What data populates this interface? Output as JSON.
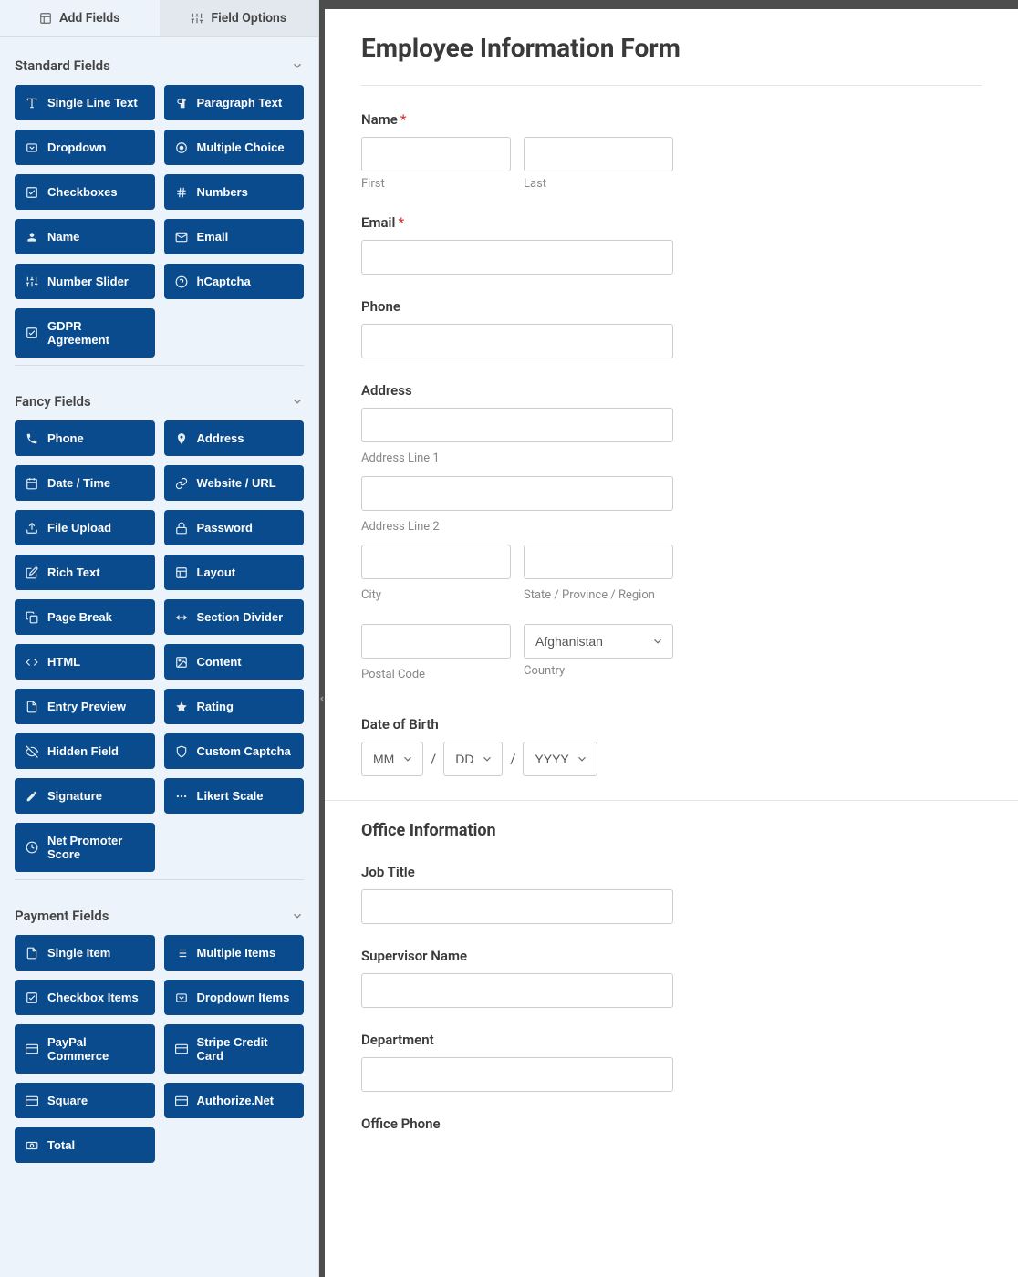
{
  "tabs": {
    "add_fields": "Add Fields",
    "field_options": "Field Options"
  },
  "sections": {
    "standard": {
      "title": "Standard Fields",
      "fields": [
        {
          "icon": "text-icon",
          "label": "Single Line Text"
        },
        {
          "icon": "paragraph-icon",
          "label": "Paragraph Text"
        },
        {
          "icon": "dropdown-icon",
          "label": "Dropdown"
        },
        {
          "icon": "radio-icon",
          "label": "Multiple Choice"
        },
        {
          "icon": "check-icon",
          "label": "Checkboxes"
        },
        {
          "icon": "hash-icon",
          "label": "Numbers"
        },
        {
          "icon": "user-icon",
          "label": "Name"
        },
        {
          "icon": "mail-icon",
          "label": "Email"
        },
        {
          "icon": "sliders-icon",
          "label": "Number Slider"
        },
        {
          "icon": "help-icon",
          "label": "hCaptcha"
        },
        {
          "icon": "check-icon",
          "label": "GDPR Agreement"
        }
      ]
    },
    "fancy": {
      "title": "Fancy Fields",
      "fields": [
        {
          "icon": "phone-icon",
          "label": "Phone"
        },
        {
          "icon": "map-pin-icon",
          "label": "Address"
        },
        {
          "icon": "calendar-icon",
          "label": "Date / Time"
        },
        {
          "icon": "link-icon",
          "label": "Website / URL"
        },
        {
          "icon": "upload-icon",
          "label": "File Upload"
        },
        {
          "icon": "lock-icon",
          "label": "Password"
        },
        {
          "icon": "edit-icon",
          "label": "Rich Text"
        },
        {
          "icon": "layout-icon",
          "label": "Layout"
        },
        {
          "icon": "copy-icon",
          "label": "Page Break"
        },
        {
          "icon": "divide-icon",
          "label": "Section Divider"
        },
        {
          "icon": "code-icon",
          "label": "HTML"
        },
        {
          "icon": "image-icon",
          "label": "Content"
        },
        {
          "icon": "file-icon",
          "label": "Entry Preview"
        },
        {
          "icon": "star-icon",
          "label": "Rating"
        },
        {
          "icon": "eye-off-icon",
          "label": "Hidden Field"
        },
        {
          "icon": "shield-icon",
          "label": "Custom Captcha"
        },
        {
          "icon": "pen-icon",
          "label": "Signature"
        },
        {
          "icon": "dots-icon",
          "label": "Likert Scale"
        },
        {
          "icon": "gauge-icon",
          "label": "Net Promoter Score"
        }
      ]
    },
    "payment": {
      "title": "Payment Fields",
      "fields": [
        {
          "icon": "file-icon",
          "label": "Single Item"
        },
        {
          "icon": "list-icon",
          "label": "Multiple Items"
        },
        {
          "icon": "check-icon",
          "label": "Checkbox Items"
        },
        {
          "icon": "dropdown-icon",
          "label": "Dropdown Items"
        },
        {
          "icon": "card-icon",
          "label": "PayPal Commerce"
        },
        {
          "icon": "card-icon",
          "label": "Stripe Credit Card"
        },
        {
          "icon": "card-icon",
          "label": "Square"
        },
        {
          "icon": "card-icon",
          "label": "Authorize.Net"
        },
        {
          "icon": "money-icon",
          "label": "Total"
        }
      ]
    }
  },
  "form": {
    "title": "Employee Information Form",
    "fields": {
      "name_label": "Name",
      "name_first": "First",
      "name_last": "Last",
      "email_label": "Email",
      "phone_label": "Phone",
      "address_label": "Address",
      "address_line1": "Address Line 1",
      "address_line2": "Address Line 2",
      "city": "City",
      "state": "State / Province / Region",
      "postal": "Postal Code",
      "country": "Country",
      "country_value": "Afghanistan",
      "dob_label": "Date of Birth",
      "dob_mm": "MM",
      "dob_dd": "DD",
      "dob_yyyy": "YYYY",
      "section2_title": "Office Information",
      "job_title": "Job Title",
      "supervisor": "Supervisor Name",
      "department": "Department",
      "office_phone": "Office Phone"
    }
  }
}
